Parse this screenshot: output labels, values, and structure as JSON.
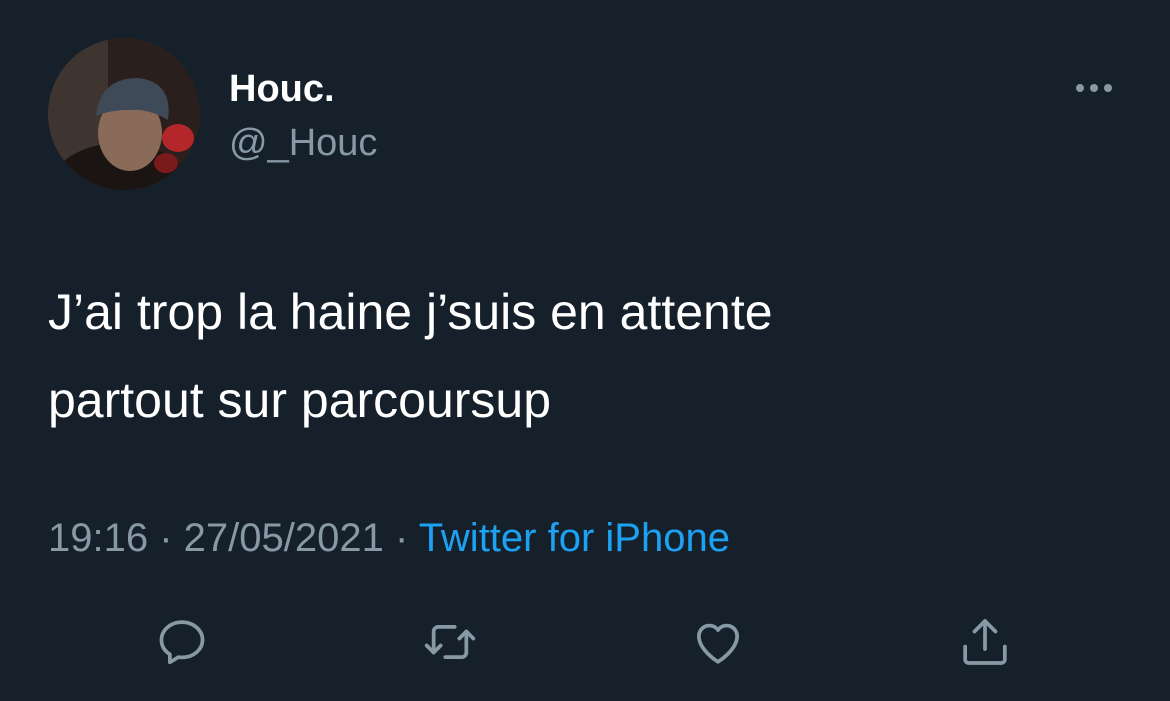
{
  "tweet": {
    "display_name": "Houc.",
    "handle": "@_Houc",
    "text": "J’ai trop la haine j’suis en attente\npartout sur parcoursup",
    "time": "19:16",
    "date": "27/05/2021",
    "separator": " · ",
    "source": "Twitter for iPhone"
  },
  "icons": {
    "more": "more-horizontal-icon",
    "reply": "reply-icon",
    "retweet": "retweet-icon",
    "like": "like-icon",
    "share": "share-icon"
  },
  "colors": {
    "background": "#15202b",
    "primary_text": "#ffffff",
    "secondary_text": "#8899a6",
    "accent": "#1da1f2"
  }
}
